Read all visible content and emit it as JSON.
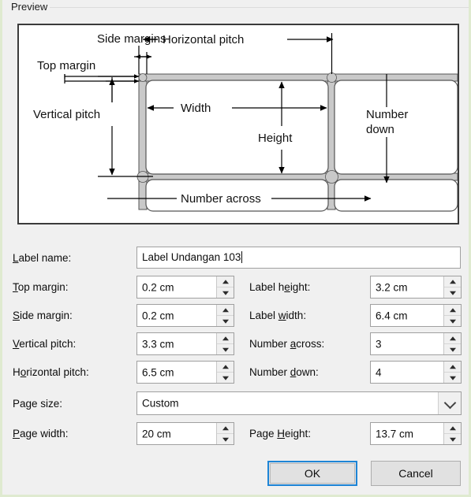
{
  "dialog": {
    "accent_color": "#1e85d6",
    "background": "#f0f0f0"
  },
  "preview": {
    "group_label": "Preview",
    "diagram": {
      "labels": {
        "side_margins": "Side margins",
        "top_margin": "Top margin",
        "horizontal_pitch": "Horizontal pitch",
        "vertical_pitch": "Vertical pitch",
        "width": "Width",
        "height": "Height",
        "number_down_line1": "Number",
        "number_down_line2": "down",
        "number_across": "Number across"
      }
    }
  },
  "form": {
    "label_name": {
      "label_pre": "",
      "label_accel": "L",
      "label_post": "abel name:",
      "value": "Label Undangan 103"
    },
    "left_fields": [
      {
        "label_pre": "",
        "label_accel": "T",
        "label_post": "op margin:",
        "value": "0.2 cm"
      },
      {
        "label_pre": "",
        "label_accel": "S",
        "label_post": "ide margin:",
        "value": "0.2 cm"
      },
      {
        "label_pre": "",
        "label_accel": "V",
        "label_post": "ertical pitch:",
        "value": "3.3 cm"
      },
      {
        "label_pre": "H",
        "label_accel": "o",
        "label_post": "rizontal pitch:",
        "value": "6.5 cm"
      }
    ],
    "right_fields": [
      {
        "label_pre": "Label h",
        "label_accel": "e",
        "label_post": "ight:",
        "value": "3.2 cm"
      },
      {
        "label_pre": "Label ",
        "label_accel": "w",
        "label_post": "idth:",
        "value": "6.4 cm"
      },
      {
        "label_pre": "Number ",
        "label_accel": "a",
        "label_post": "cross:",
        "value": "3"
      },
      {
        "label_pre": "Number ",
        "label_accel": "d",
        "label_post": "own:",
        "value": "4"
      }
    ],
    "page_size": {
      "label_pre": "Page size:",
      "label_accel": "",
      "label_post": "",
      "value": "Custom"
    },
    "page_width": {
      "label_pre": "",
      "label_accel": "P",
      "label_post": "age width:",
      "value": "20 cm"
    },
    "page_height": {
      "label_pre": "Page ",
      "label_accel": "H",
      "label_post": "eight:",
      "value": "13.7 cm"
    }
  },
  "buttons": {
    "ok": "OK",
    "cancel": "Cancel"
  }
}
